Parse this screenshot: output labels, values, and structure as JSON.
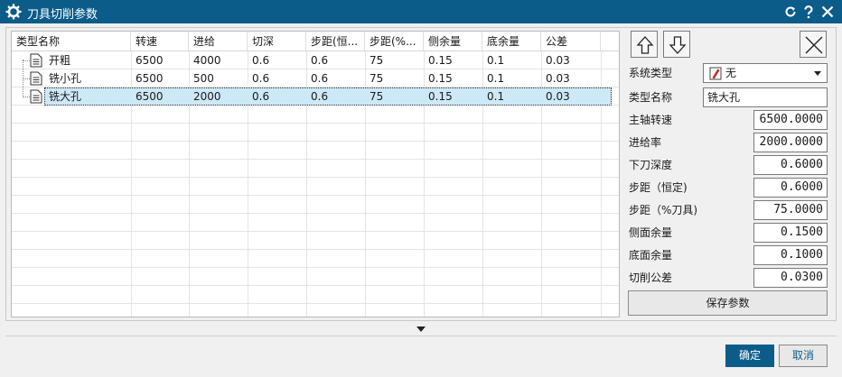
{
  "window": {
    "title": "刀具切削参数"
  },
  "table": {
    "headers": [
      "类型名称",
      "转速",
      "进给",
      "切深",
      "步距(恒...",
      "步距(%...",
      "侧余量",
      "底余量",
      "公差"
    ],
    "rows": [
      [
        "开粗",
        "6500",
        "4000",
        "0.6",
        "0.6",
        "75",
        "0.15",
        "0.1",
        "0.03"
      ],
      [
        "铣小孔",
        "6500",
        "500",
        "0.6",
        "0.6",
        "75",
        "0.15",
        "0.1",
        "0.03"
      ],
      [
        "铣大孔",
        "6500",
        "2000",
        "0.6",
        "0.6",
        "75",
        "0.15",
        "0.1",
        "0.03"
      ]
    ],
    "selected_row": 2
  },
  "panel": {
    "system_type_label": "系统类型",
    "system_type_value": "无",
    "type_name_label": "类型名称",
    "type_name_value": "铣大孔",
    "fields": [
      {
        "label": "主轴转速",
        "value": "6500.0000"
      },
      {
        "label": "进给率",
        "value": "2000.0000"
      },
      {
        "label": "下刀深度",
        "value": "0.6000"
      },
      {
        "label": "步距（恒定)",
        "value": "0.6000"
      },
      {
        "label": "步距（%刀具)",
        "value": "75.0000"
      },
      {
        "label": "侧面余量",
        "value": "0.1500"
      },
      {
        "label": "底面余量",
        "value": "0.1000"
      },
      {
        "label": "切削公差",
        "value": "0.0300"
      }
    ],
    "save_label": "保存参数"
  },
  "footer": {
    "ok_label": "确定",
    "cancel_label": "取消"
  },
  "colors": {
    "titlebar": "#0c5c8a",
    "selection": "#cde8f6"
  },
  "icons": [
    "gear-icon",
    "reset-icon",
    "help-icon",
    "close-icon",
    "arrow-up-icon",
    "arrow-down-icon",
    "delete-x-icon",
    "document-icon",
    "pencil-icon",
    "expand-down-icon"
  ]
}
